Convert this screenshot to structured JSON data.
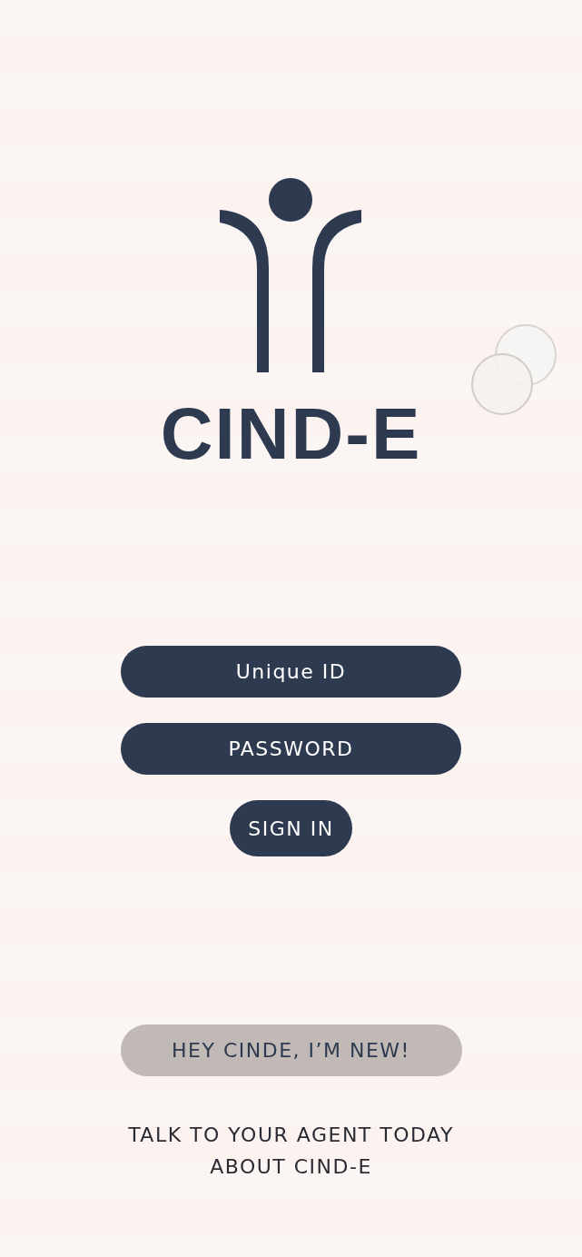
{
  "logo": {
    "text": "CIND-E"
  },
  "login_form": {
    "fields": [
      {
        "placeholder": "Unique ID"
      },
      {
        "placeholder": "PASSWORD"
      }
    ],
    "submit": "SIGN IN"
  },
  "new_user_button": "HEY CINDE, I’M NEW!",
  "footer_note": "TALK TO YOUR AGENT TODAY\nABOUT CIND-E"
}
